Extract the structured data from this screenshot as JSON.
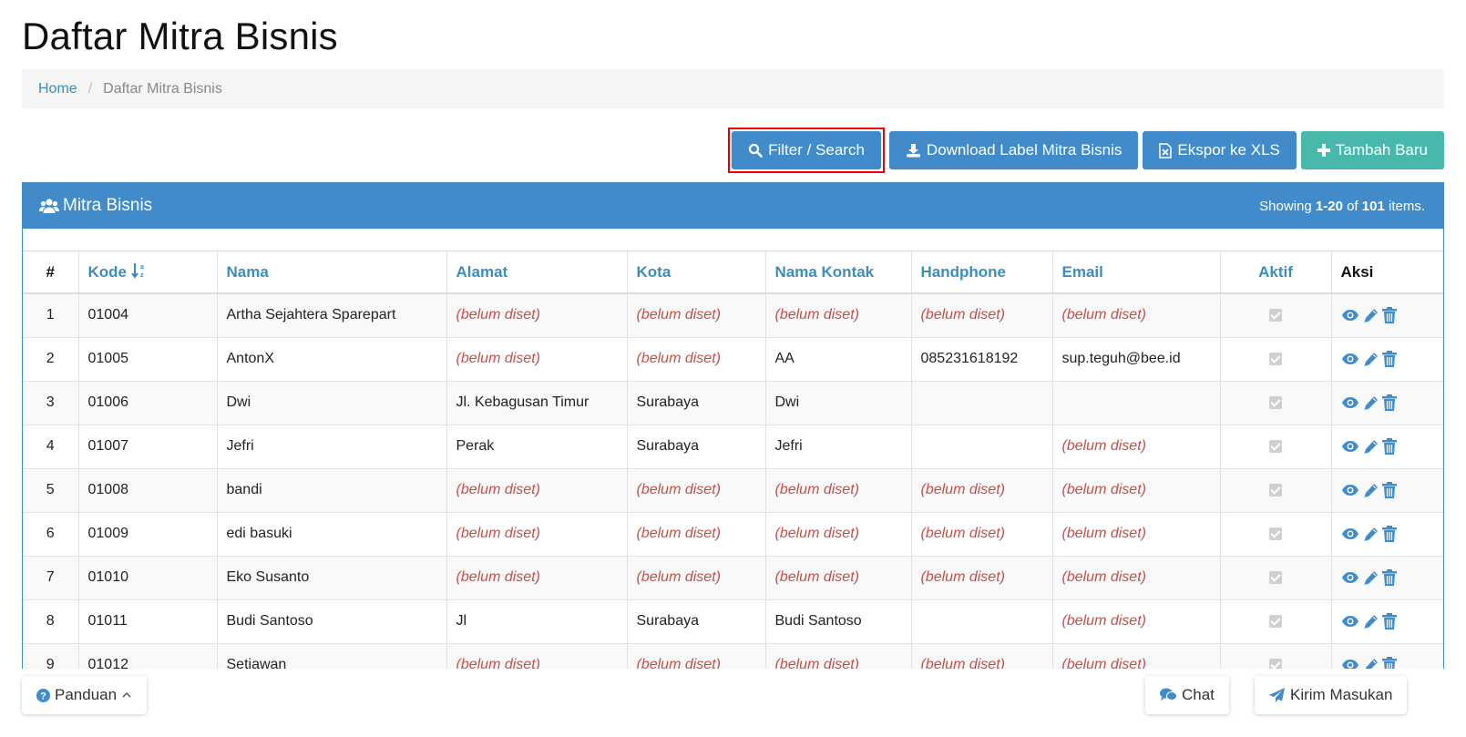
{
  "page": {
    "title": "Daftar Mitra Bisnis"
  },
  "breadcrumb": {
    "home": "Home",
    "separator": "/",
    "current": "Daftar Mitra Bisnis"
  },
  "toolbar": {
    "filter_label": "Filter / Search",
    "download_label": "Download Label Mitra Bisnis",
    "export_label": "Ekspor ke XLS",
    "add_label": "Tambah Baru"
  },
  "panel": {
    "title": "Mitra Bisnis",
    "summary_prefix": "Showing ",
    "summary_range": "1-20",
    "summary_of": " of ",
    "summary_total": "101",
    "summary_suffix": " items."
  },
  "table": {
    "headers": {
      "num": "#",
      "kode": "Kode",
      "nama": "Nama",
      "alamat": "Alamat",
      "kota": "Kota",
      "kontak": "Nama Kontak",
      "hp": "Handphone",
      "email": "Email",
      "aktif": "Aktif",
      "aksi": "Aksi"
    },
    "unset_text": "(belum diset)",
    "rows": [
      {
        "no": "1",
        "kode": "01004",
        "nama": "Artha Sejahtera Sparepart",
        "alamat": null,
        "kota": null,
        "kontak": null,
        "hp": null,
        "email": null,
        "aktif": true
      },
      {
        "no": "2",
        "kode": "01005",
        "nama": "AntonX",
        "alamat": null,
        "kota": null,
        "kontak": "AA",
        "hp": "085231618192",
        "email": "sup.teguh@bee.id",
        "aktif": true
      },
      {
        "no": "3",
        "kode": "01006",
        "nama": "Dwi",
        "alamat": "Jl. Kebagusan Timur",
        "kota": "Surabaya",
        "kontak": "Dwi",
        "hp": "",
        "email": "",
        "aktif": true
      },
      {
        "no": "4",
        "kode": "01007",
        "nama": "Jefri",
        "alamat": "Perak",
        "kota": "Surabaya",
        "kontak": "Jefri",
        "hp": "",
        "email": null,
        "aktif": true
      },
      {
        "no": "5",
        "kode": "01008",
        "nama": "bandi",
        "alamat": null,
        "kota": null,
        "kontak": null,
        "hp": null,
        "email": null,
        "aktif": true
      },
      {
        "no": "6",
        "kode": "01009",
        "nama": "edi basuki",
        "alamat": null,
        "kota": null,
        "kontak": null,
        "hp": null,
        "email": null,
        "aktif": true
      },
      {
        "no": "7",
        "kode": "01010",
        "nama": "Eko Susanto",
        "alamat": null,
        "kota": null,
        "kontak": null,
        "hp": null,
        "email": null,
        "aktif": true
      },
      {
        "no": "8",
        "kode": "01011",
        "nama": "Budi Santoso",
        "alamat": "Jl",
        "kota": "Surabaya",
        "kontak": "Budi Santoso",
        "hp": "",
        "email": null,
        "aktif": true
      },
      {
        "no": "9",
        "kode": "01012",
        "nama": "Setiawan",
        "alamat": null,
        "kota": null,
        "kontak": null,
        "hp": null,
        "email": null,
        "aktif": true
      }
    ]
  },
  "footer": {
    "panduan_label": "Panduan",
    "chat_label": "Chat",
    "kirim_label": "Kirim Masukan"
  },
  "colors": {
    "primary": "#428bca",
    "success": "#47b8a9",
    "unset": "#c0504d",
    "highlight": "#ee0000"
  }
}
